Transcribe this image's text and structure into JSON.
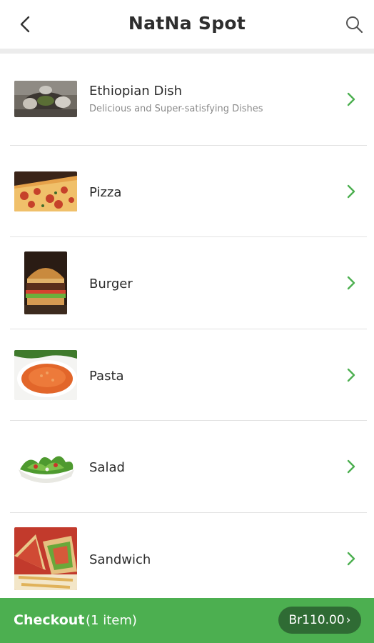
{
  "header": {
    "title": "NatNa Spot",
    "back_icon": "chevron-left-icon",
    "search_icon": "search-icon"
  },
  "categories": [
    {
      "label": "Ethiopian Dish",
      "subtitle": "Delicious and Super-satisfying Dishes",
      "image": "ethiopian-dish-photo"
    },
    {
      "label": "Pizza",
      "subtitle": "",
      "image": "pizza-photo"
    },
    {
      "label": "Burger",
      "subtitle": "",
      "image": "burger-photo"
    },
    {
      "label": "Pasta",
      "subtitle": "",
      "image": "pasta-photo"
    },
    {
      "label": "Salad",
      "subtitle": "",
      "image": "salad-photo"
    },
    {
      "label": "Sandwich",
      "subtitle": "",
      "image": "sandwich-photo"
    }
  ],
  "checkout": {
    "label": "Checkout",
    "count": "(1 item)",
    "price": "Br110.00",
    "price_chevron": "›"
  },
  "colors": {
    "accent_green": "#4caf50",
    "pill_dark_green": "#2f6b34",
    "chevron_green": "#4caf50"
  }
}
